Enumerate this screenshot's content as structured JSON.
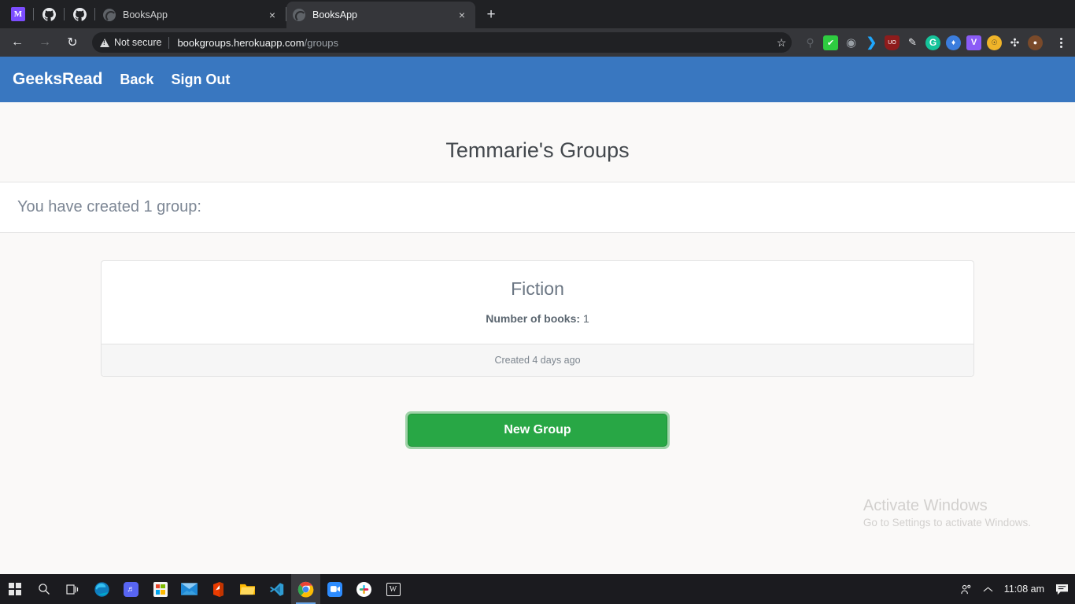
{
  "browser": {
    "pinned": [
      {
        "name": "monad-icon",
        "glyph": "M"
      },
      {
        "name": "github-icon",
        "glyph": ""
      },
      {
        "name": "github-icon-2",
        "glyph": ""
      }
    ],
    "tabs": [
      {
        "title": "BooksApp",
        "active": false
      },
      {
        "title": "BooksApp",
        "active": true
      }
    ],
    "new_tab_label": "+",
    "close_label": "×",
    "back_label": "←",
    "forward_label": "→",
    "reload_label": "↻",
    "security_label": "Not secure",
    "url_host": "bookgroups.herokuapp.com",
    "url_path": "/groups",
    "bookmark_label": "☆",
    "extensions": [
      {
        "name": "search-shield-icon",
        "glyph": "ⓘ",
        "bg": "transparent",
        "color": "#5f6368"
      },
      {
        "name": "checkmark-icon",
        "glyph": "✔",
        "bg": "#2ecc40",
        "color": "#ffffff"
      },
      {
        "name": "circle-dots-icon",
        "glyph": "◌",
        "bg": "transparent",
        "color": "#9aa0a6"
      },
      {
        "name": "crescent-icon",
        "glyph": "☾",
        "bg": "transparent",
        "color": "#1ea7fd"
      },
      {
        "name": "ublock-origin-icon",
        "glyph": "UO",
        "bg": "#8e1c1c",
        "color": "#ffffff"
      },
      {
        "name": "pen-icon",
        "glyph": "✐",
        "bg": "transparent",
        "color": "#e8eaed"
      },
      {
        "name": "grammarly-icon",
        "glyph": "G",
        "bg": "#15c39a",
        "color": "#ffffff"
      },
      {
        "name": "ethereum-icon",
        "glyph": "◆",
        "bg": "#3b7ddd",
        "color": "#ffffff"
      },
      {
        "name": "vimium-icon",
        "glyph": "V",
        "bg": "#8b5cf6",
        "color": "#ffffff"
      },
      {
        "name": "nerd-face-icon",
        "glyph": "ᾑ3",
        "bg": "#f0b429",
        "color": "#ffffff"
      },
      {
        "name": "puzzle-extensions-icon",
        "glyph": "✻",
        "bg": "transparent",
        "color": "#e8eaed"
      },
      {
        "name": "profile-avatar",
        "glyph": "●",
        "bg": "#8d5524",
        "color": "#ffffff"
      }
    ]
  },
  "navbar": {
    "brand": "GeeksRead",
    "links": [
      {
        "label": "Back"
      },
      {
        "label": "Sign Out"
      }
    ]
  },
  "main": {
    "page_title": "Temmarie's Groups",
    "alert_text": "You have created 1 group:",
    "group_card": {
      "title": "Fiction",
      "books_label": "Number of books:",
      "books_count": "1",
      "footer": "Created 4 days ago"
    },
    "new_group_button": "New Group"
  },
  "watermark": {
    "line1": "Activate Windows",
    "line2": "Go to Settings to activate Windows."
  },
  "taskbar": {
    "items": [
      {
        "name": "start-button",
        "glyph": "win",
        "bg": "transparent",
        "color": "#e6e6e6"
      },
      {
        "name": "search-icon",
        "glyph": "⌕",
        "bg": "transparent",
        "color": "#e6e6e6"
      },
      {
        "name": "task-view-icon",
        "glyph": "⌸",
        "bg": "transparent",
        "color": "#e6e6e6"
      },
      {
        "name": "microsoft-edge-icon",
        "glyph": "e",
        "bg": "transparent",
        "color": "#2db4e6"
      },
      {
        "name": "discord-icon",
        "glyph": "▬",
        "bg": "#5865f2",
        "color": "#ffffff"
      },
      {
        "name": "microsoft-store-icon",
        "glyph": "⊞",
        "bg": "#f2f2f2",
        "color": "#e8452b"
      },
      {
        "name": "mail-icon",
        "glyph": "✉",
        "bg": "transparent",
        "color": "#2b88d8"
      },
      {
        "name": "office-icon",
        "glyph": "◗",
        "bg": "transparent",
        "color": "#eb3c00"
      },
      {
        "name": "file-explorer-icon",
        "glyph": "☰",
        "bg": "transparent",
        "color": "#ffb900"
      },
      {
        "name": "vs-code-icon",
        "glyph": "⊲",
        "bg": "transparent",
        "color": "#2f9cd3"
      },
      {
        "name": "google-chrome-icon",
        "glyph": "●",
        "bg": "transparent",
        "color": "#4285f4",
        "active": true
      },
      {
        "name": "zoom-icon",
        "glyph": "▶",
        "bg": "#2d8cff",
        "color": "#ffffff"
      },
      {
        "name": "slack-icon",
        "glyph": "✸",
        "bg": "#ffffff",
        "color": "#e01e5a"
      },
      {
        "name": "wordpad-icon",
        "glyph": "□",
        "bg": "transparent",
        "color": "#f2f2f2"
      }
    ],
    "tray": {
      "people_icon": "⚬",
      "chevron_up": "∧",
      "clock": "11:08 am",
      "notification_icon": "▤"
    }
  }
}
